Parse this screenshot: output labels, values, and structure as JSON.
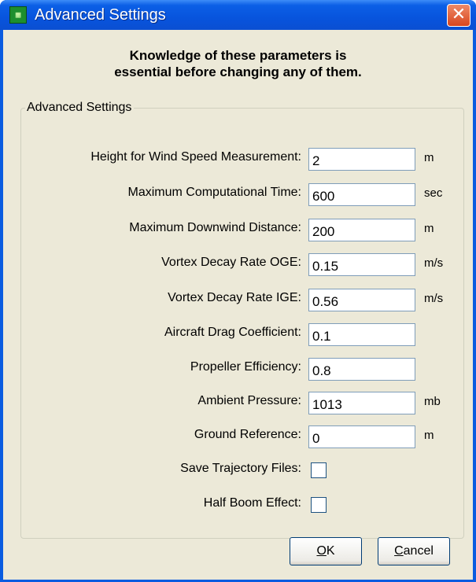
{
  "window": {
    "title": "Advanced Settings",
    "app_icon": "program-icon",
    "close_glyph": "✕"
  },
  "warning": {
    "line1": "Knowledge of these parameters is",
    "line2": "essential before changing any of them."
  },
  "group": {
    "legend": "Advanced Settings"
  },
  "fields": [
    {
      "label": "Height for Wind Speed Measurement:",
      "value": "2",
      "unit": "m"
    },
    {
      "label": "Maximum Computational Time:",
      "value": "600",
      "unit": "sec"
    },
    {
      "label": "Maximum Downwind Distance:",
      "value": "200",
      "unit": "m"
    },
    {
      "label": "Vortex Decay Rate OGE:",
      "value": "0.15",
      "unit": "m/s"
    },
    {
      "label": "Vortex Decay Rate IGE:",
      "value": "0.56",
      "unit": "m/s"
    },
    {
      "label": "Aircraft Drag Coefficient:",
      "value": "0.1",
      "unit": ""
    },
    {
      "label": "Propeller Efficiency:",
      "value": "0.8",
      "unit": ""
    },
    {
      "label": "Ambient Pressure:",
      "value": "1013",
      "unit": "mb"
    },
    {
      "label": "Ground Reference:",
      "value": "0",
      "unit": "m"
    }
  ],
  "checkboxes": [
    {
      "label": "Save Trajectory Files:",
      "checked": false
    },
    {
      "label": "Half Boom Effect:",
      "checked": false
    }
  ],
  "buttons": {
    "ok": {
      "accel": "O",
      "rest": "K"
    },
    "cancel": {
      "accel": "C",
      "rest": "ancel"
    }
  }
}
